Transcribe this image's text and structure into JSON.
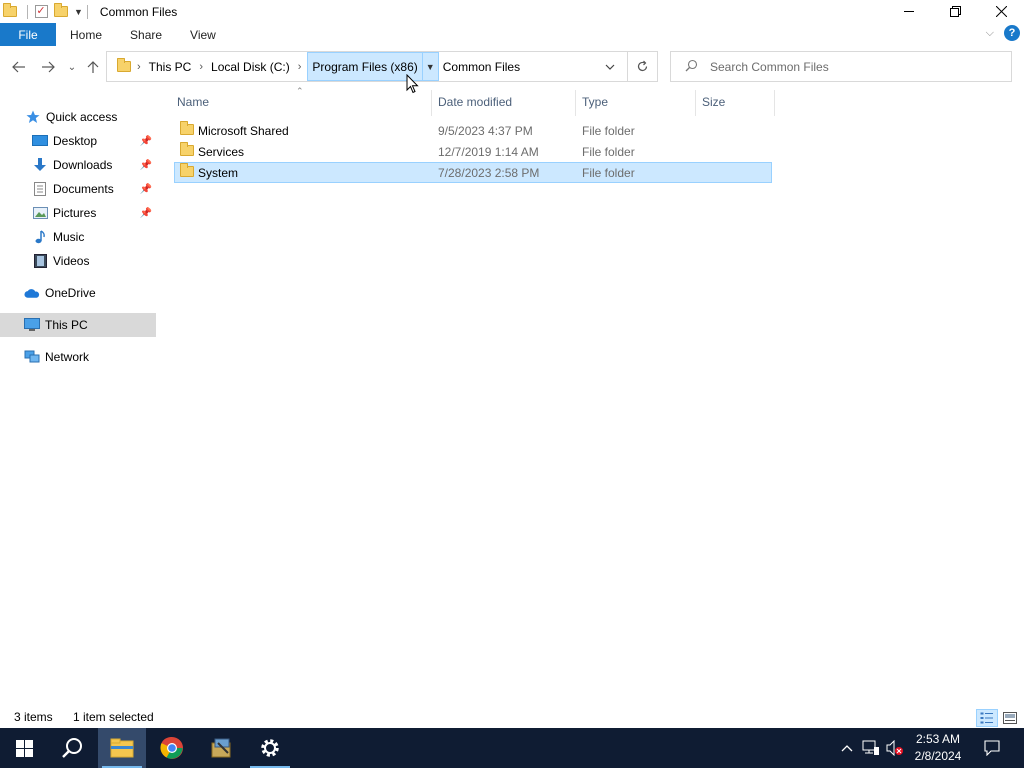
{
  "window": {
    "title": "Common Files",
    "minimize_icon": "minimize-icon",
    "maximize_icon": "restore-icon",
    "close_icon": "close-icon"
  },
  "ribbon": {
    "tabs": [
      {
        "label": "File"
      },
      {
        "label": "Home"
      },
      {
        "label": "Share"
      },
      {
        "label": "View"
      }
    ],
    "accent": "#1979ca"
  },
  "address": {
    "crumbs": [
      "This PC",
      "Local Disk (C:)",
      "Program Files (x86)"
    ],
    "current": "Common Files",
    "active_crumb": "Program Files (x86)"
  },
  "search": {
    "placeholder": "Search Common Files"
  },
  "sidebar": {
    "items": [
      {
        "label": "Quick access",
        "icon": "star-icon",
        "pinned": false
      },
      {
        "label": "Desktop",
        "icon": "desktop-icon",
        "pinned": true
      },
      {
        "label": "Downloads",
        "icon": "download-icon",
        "pinned": true
      },
      {
        "label": "Documents",
        "icon": "documents-icon",
        "pinned": true
      },
      {
        "label": "Pictures",
        "icon": "pictures-icon",
        "pinned": true
      },
      {
        "label": "Music",
        "icon": "music-icon",
        "pinned": false
      },
      {
        "label": "Videos",
        "icon": "videos-icon",
        "pinned": false
      },
      {
        "label": "OneDrive",
        "icon": "cloud-icon",
        "pinned": false
      },
      {
        "label": "This PC",
        "icon": "computer-icon",
        "pinned": false,
        "selected": true
      },
      {
        "label": "Network",
        "icon": "network-icon",
        "pinned": false
      }
    ]
  },
  "columns": {
    "name": "Name",
    "date": "Date modified",
    "type": "Type",
    "size": "Size"
  },
  "files": [
    {
      "name": "Microsoft Shared",
      "date": "9/5/2023 4:37 PM",
      "type": "File folder",
      "selected": false
    },
    {
      "name": "Services",
      "date": "12/7/2019 1:14 AM",
      "type": "File folder",
      "selected": false
    },
    {
      "name": "System",
      "date": "7/28/2023 2:58 PM",
      "type": "File folder",
      "selected": true
    }
  ],
  "status": {
    "count": "3 items",
    "selection": "1 item selected"
  },
  "taskbar": {
    "apps": [
      "start-icon",
      "search-icon",
      "file-explorer-icon",
      "chrome-icon",
      "installer-icon",
      "settings-icon"
    ],
    "tray_icons": [
      "chevron-up-icon",
      "network-icon",
      "volume-muted-icon"
    ],
    "time": "2:53 AM",
    "date": "2/8/2024"
  }
}
